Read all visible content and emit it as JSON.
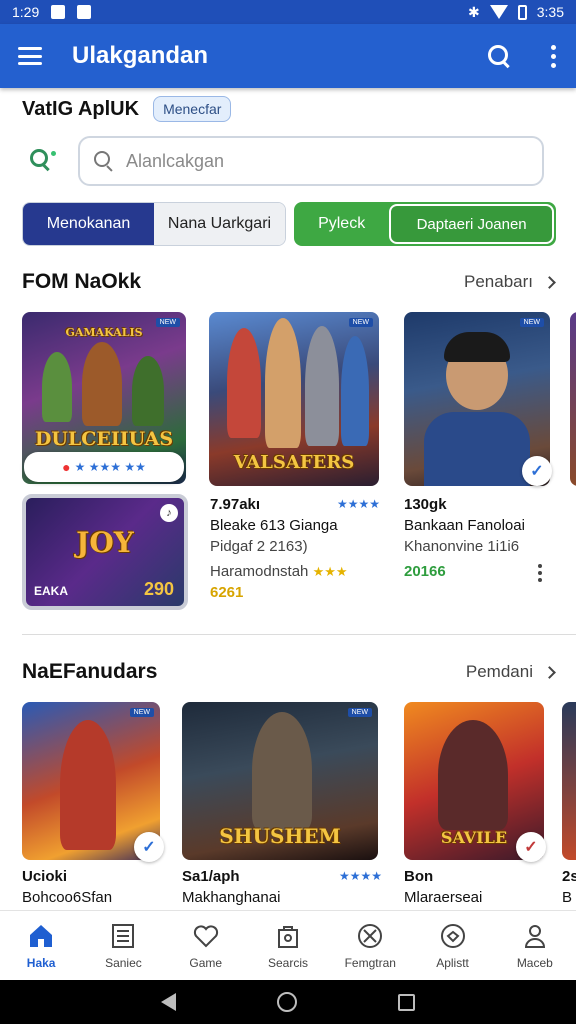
{
  "status_bar": {
    "time_left": "1:29",
    "time_right": "3:35"
  },
  "app_bar": {
    "title": "Ulakgandan"
  },
  "header": {
    "subtitle": "VatIG AplUK",
    "chip": "Menecfar"
  },
  "search": {
    "placeholder": "Alanlcakgan"
  },
  "filters": {
    "seg1": "Menokanan",
    "seg2": "Nana Uarkgari",
    "seg3": "Pyleck",
    "seg4": "Daptaeri Joanen"
  },
  "section1": {
    "title": "FOM NaOkk",
    "more": "Penabarı",
    "featured_card": {
      "art_title": "DULCEIIUAS",
      "art_top": "GAMAKALIS"
    },
    "mini_card": {
      "art_title": "JOY",
      "corner_label": "EAKA",
      "price": "290"
    },
    "items": [
      {
        "art_title": "VALSAFERS",
        "price": "7.97akı",
        "name": "Bleake 613 Gianga",
        "sub": "Pidgaf 2 2163)",
        "dev": "Haramodnstah",
        "rating": "6261"
      },
      {
        "price": "130gk",
        "name": "Bankaan Fanoloai",
        "sub": "Khanonvine 1i1i6",
        "score": "20166"
      }
    ]
  },
  "section2": {
    "title": "NaEFanudars",
    "more": "Pemdani",
    "items": [
      {
        "name": "Ucioki",
        "sub": "Bohcoo6Sfan"
      },
      {
        "art_title": "SHUSHEM",
        "name": "Sa1/aph",
        "sub": "Makhanghanai"
      },
      {
        "art_title": "SAVILE",
        "name": "Bon",
        "sub": "Mlaraerseai"
      },
      {
        "name": "2s",
        "sub": "B"
      }
    ]
  },
  "bottom_nav": [
    {
      "label": "Haka",
      "icon": "home-icon"
    },
    {
      "label": "Saniec",
      "icon": "list-icon"
    },
    {
      "label": "Game",
      "icon": "heart-icon"
    },
    {
      "label": "Searcis",
      "icon": "bag-icon"
    },
    {
      "label": "Femgtran",
      "icon": "sword-icon"
    },
    {
      "label": "Aplistt",
      "icon": "shield-icon"
    },
    {
      "label": "Maceb",
      "icon": "person-icon"
    }
  ],
  "colors": {
    "status_bar": "#1f4fb8",
    "app_bar": "#2460cf",
    "segment_active": "#26398f",
    "segment_green": "#3ea843",
    "nav_active": "#1f5fd1"
  }
}
